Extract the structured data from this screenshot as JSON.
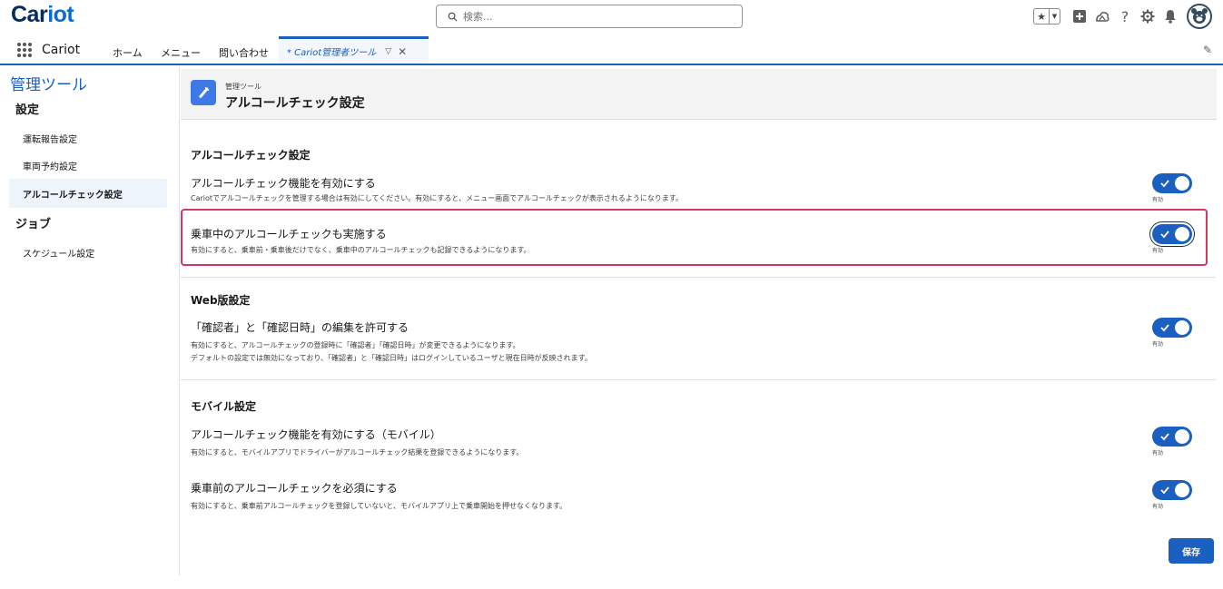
{
  "header": {
    "logo_main": "Car",
    "logo_accent": "iot",
    "search_placeholder": "検索...",
    "icons": [
      "favorites-star-icon",
      "add-icon",
      "trailhead-icon",
      "help-icon",
      "settings-icon",
      "notification-bell-icon",
      "user-avatar"
    ]
  },
  "nav": {
    "app_name": "Cariot",
    "items": [
      "ホーム",
      "メニュー",
      "問い合わせ"
    ],
    "active_tab": "* Cariot管理者ツール"
  },
  "sidebar": {
    "title": "管理ツール",
    "section_settings": "設定",
    "items_settings": [
      "運転報告設定",
      "車両予約設定",
      "アルコールチェック設定"
    ],
    "section_jobs": "ジョブ",
    "items_jobs": [
      "スケジュール設定"
    ]
  },
  "page_header": {
    "small": "管理ツール",
    "title": "アルコールチェック設定"
  },
  "sections": [
    {
      "title": "アルコールチェック設定",
      "settings": [
        {
          "label": "アルコールチェック機能を有効にする",
          "desc": "Cariotでアルコールチェックを管理する場合は有効にしてください。有効にすると、メニュー画面でアルコールチェックが表示されるようになります。",
          "enabled": true,
          "status": "有効"
        },
        {
          "label": "乗車中のアルコールチェックも実施する",
          "desc": "有効にすると、乗車前・乗車後だけでなく、乗車中のアルコールチェックも記録できるようになります。",
          "enabled": true,
          "status": "有効"
        }
      ]
    },
    {
      "title": "Web版設定",
      "settings": [
        {
          "label": "「確認者」と「確認日時」の編集を許可する",
          "desc": "有効にすると、アルコールチェックの登録時に「確認者」「確認日時」が変更できるようになります。",
          "desc2": "デフォルトの設定では無効になっており、「確認者」と「確認日時」はログインしているユーザと現在日時が反映されます。",
          "enabled": true,
          "status": "有効"
        }
      ]
    },
    {
      "title": "モバイル設定",
      "settings": [
        {
          "label": "アルコールチェック機能を有効にする（モバイル）",
          "desc": "有効にすると、モバイルアプリでドライバーがアルコールチェック結果を登録できるようになります。",
          "enabled": true,
          "status": "有効"
        },
        {
          "label": "乗車前のアルコールチェックを必須にする",
          "desc": "有効にすると、乗車前アルコールチェックを登録していないと、モバイルアプリ上で乗車開始を押せなくなります。",
          "enabled": true,
          "status": "有効"
        }
      ]
    }
  ],
  "save_label": "保存",
  "colors": {
    "brand_blue": "#1b5fc1",
    "logo_navy": "#032d60",
    "highlight_pink": "#d6365f"
  }
}
